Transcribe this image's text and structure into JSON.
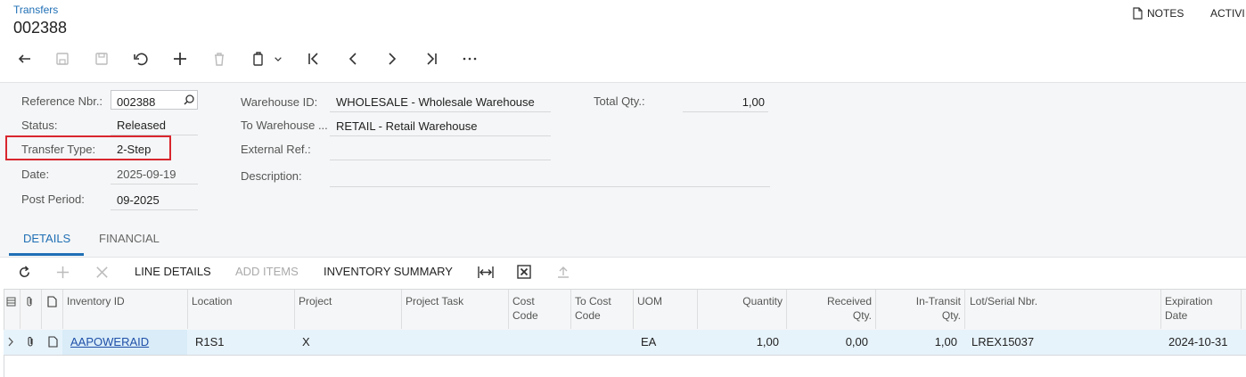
{
  "breadcrumb": "Transfers",
  "title": "002388",
  "topright": {
    "notes": "NOTES",
    "activity": "ACTIVI"
  },
  "form": {
    "reference_label": "Reference Nbr.:",
    "reference_value": "002388",
    "status_label": "Status:",
    "status_value": "Released",
    "transfer_type_label": "Transfer Type:",
    "transfer_type_value": "2-Step",
    "date_label": "Date:",
    "date_value": "2025-09-19",
    "post_period_label": "Post Period:",
    "post_period_value": "09-2025",
    "warehouse_label": "Warehouse ID:",
    "warehouse_value": "WHOLESALE - Wholesale Warehouse",
    "to_warehouse_label": "To Warehouse ...",
    "to_warehouse_value": "RETAIL - Retail Warehouse",
    "external_ref_label": "External Ref.:",
    "external_ref_value": "",
    "description_label": "Description:",
    "description_value": "",
    "total_qty_label": "Total Qty.:",
    "total_qty_value": "1,00"
  },
  "tabs": [
    "DETAILS",
    "FINANCIAL"
  ],
  "grid_toolbar": {
    "line_details": "LINE DETAILS",
    "add_items": "ADD ITEMS",
    "inventory_summary": "INVENTORY SUMMARY"
  },
  "columns": [
    "Inventory ID",
    "Location",
    "Project",
    "Project Task",
    "Cost Code",
    "To Cost Code",
    "UOM",
    "Quantity",
    "Received Qty.",
    "In-Transit Qty.",
    "Lot/Serial Nbr.",
    "Expiration Date"
  ],
  "rows": [
    {
      "inventory_id": "AAPOWERAID",
      "location": "R1S1",
      "project": "X",
      "project_task": "",
      "cost_code": "",
      "to_cost_code": "",
      "uom": "EA",
      "quantity": "1,00",
      "received_qty": "0,00",
      "in_transit_qty": "1,00",
      "lot_serial": "LREX15037",
      "expiration_date": "2024-10-31"
    }
  ],
  "colors": {
    "accent": "#1f6fb5",
    "highlight": "#d9262e",
    "selected_row": "#e7f3fb"
  },
  "icons": [
    "back-icon",
    "save-close-icon",
    "save-icon",
    "undo-icon",
    "add-icon",
    "delete-icon",
    "copy-paste-icon",
    "first-icon",
    "prev-icon",
    "next-icon",
    "last-icon",
    "more-icon",
    "search-icon",
    "refresh-icon",
    "fit-columns-icon",
    "excel-icon",
    "upload-icon"
  ]
}
